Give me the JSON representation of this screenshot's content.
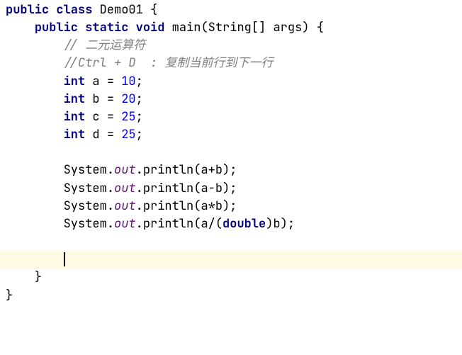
{
  "code": {
    "kw_public": "public",
    "kw_class": "class",
    "kw_static": "static",
    "kw_void": "void",
    "kw_int": "int",
    "kw_double": "double",
    "class_name": "Demo01",
    "method_name": "main",
    "param_type": "String[]",
    "param_name": "args",
    "comment1": "// 二元运算符",
    "comment2": "//Ctrl + D  : 复制当前行到下一行",
    "var_a": "a",
    "var_b": "b",
    "var_c": "c",
    "var_d": "d",
    "val_a": "10",
    "val_b": "20",
    "val_c": "25",
    "val_d": "25",
    "eq": "=",
    "semi": ";",
    "brace_open": "{",
    "brace_close": "}",
    "paren_open": "(",
    "paren_close": ")",
    "system": "System",
    "out": "out",
    "println": "println",
    "dot": ".",
    "expr1": "a+b",
    "expr2": "a-b",
    "expr3": "a*b",
    "expr4_pre": "a/(",
    "expr4_post": ")b"
  }
}
